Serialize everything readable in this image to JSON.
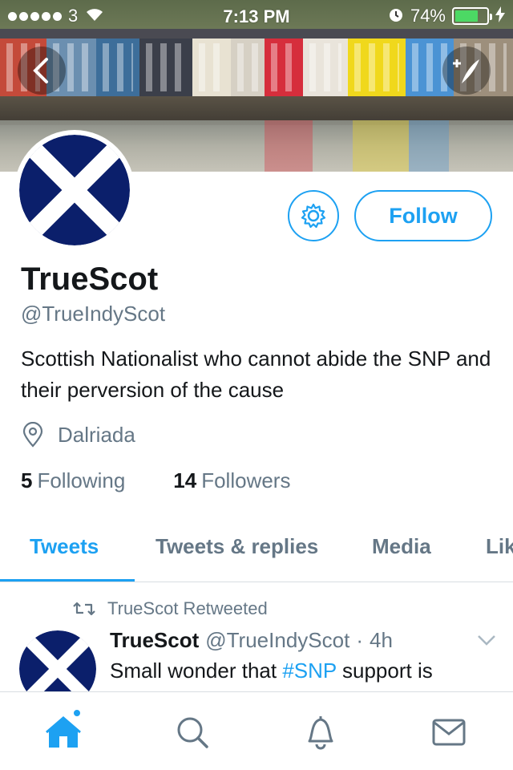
{
  "status_bar": {
    "carrier": "3",
    "time": "7:13 PM",
    "battery": "74%",
    "battery_level": 0.74
  },
  "profile": {
    "display_name": "TrueScot",
    "handle": "@TrueIndyScot",
    "bio": "Scottish Nationalist who cannot abide the SNP and their perversion of the cause",
    "location": "Dalriada",
    "following_count": "5",
    "following_label": "Following",
    "followers_count": "14",
    "followers_label": "Followers",
    "follow_button": "Follow"
  },
  "tabs": [
    {
      "label": "Tweets",
      "active": true
    },
    {
      "label": "Tweets & replies",
      "active": false
    },
    {
      "label": "Media",
      "active": false
    },
    {
      "label": "Likes",
      "active": false
    }
  ],
  "tweet": {
    "retweet_label": "TrueScot Retweeted",
    "name": "TrueScot",
    "handle": "@TrueIndyScot",
    "separator": "·",
    "age": "4h",
    "text_before": "Small wonder that ",
    "hashtag": "#SNP",
    "text_after": " support is"
  },
  "icons": {
    "back": "chevron-left-icon",
    "compose": "compose-icon",
    "settings": "gear-icon",
    "location": "location-pin-icon",
    "retweet": "retweet-icon",
    "caret": "chevron-down-icon",
    "home": "home-icon",
    "search": "search-icon",
    "notifications": "bell-icon",
    "messages": "envelope-icon"
  },
  "colors": {
    "accent": "#1da1f2",
    "muted": "#657786",
    "text": "#14171a",
    "saltire_blue": "#0b1f6b"
  }
}
